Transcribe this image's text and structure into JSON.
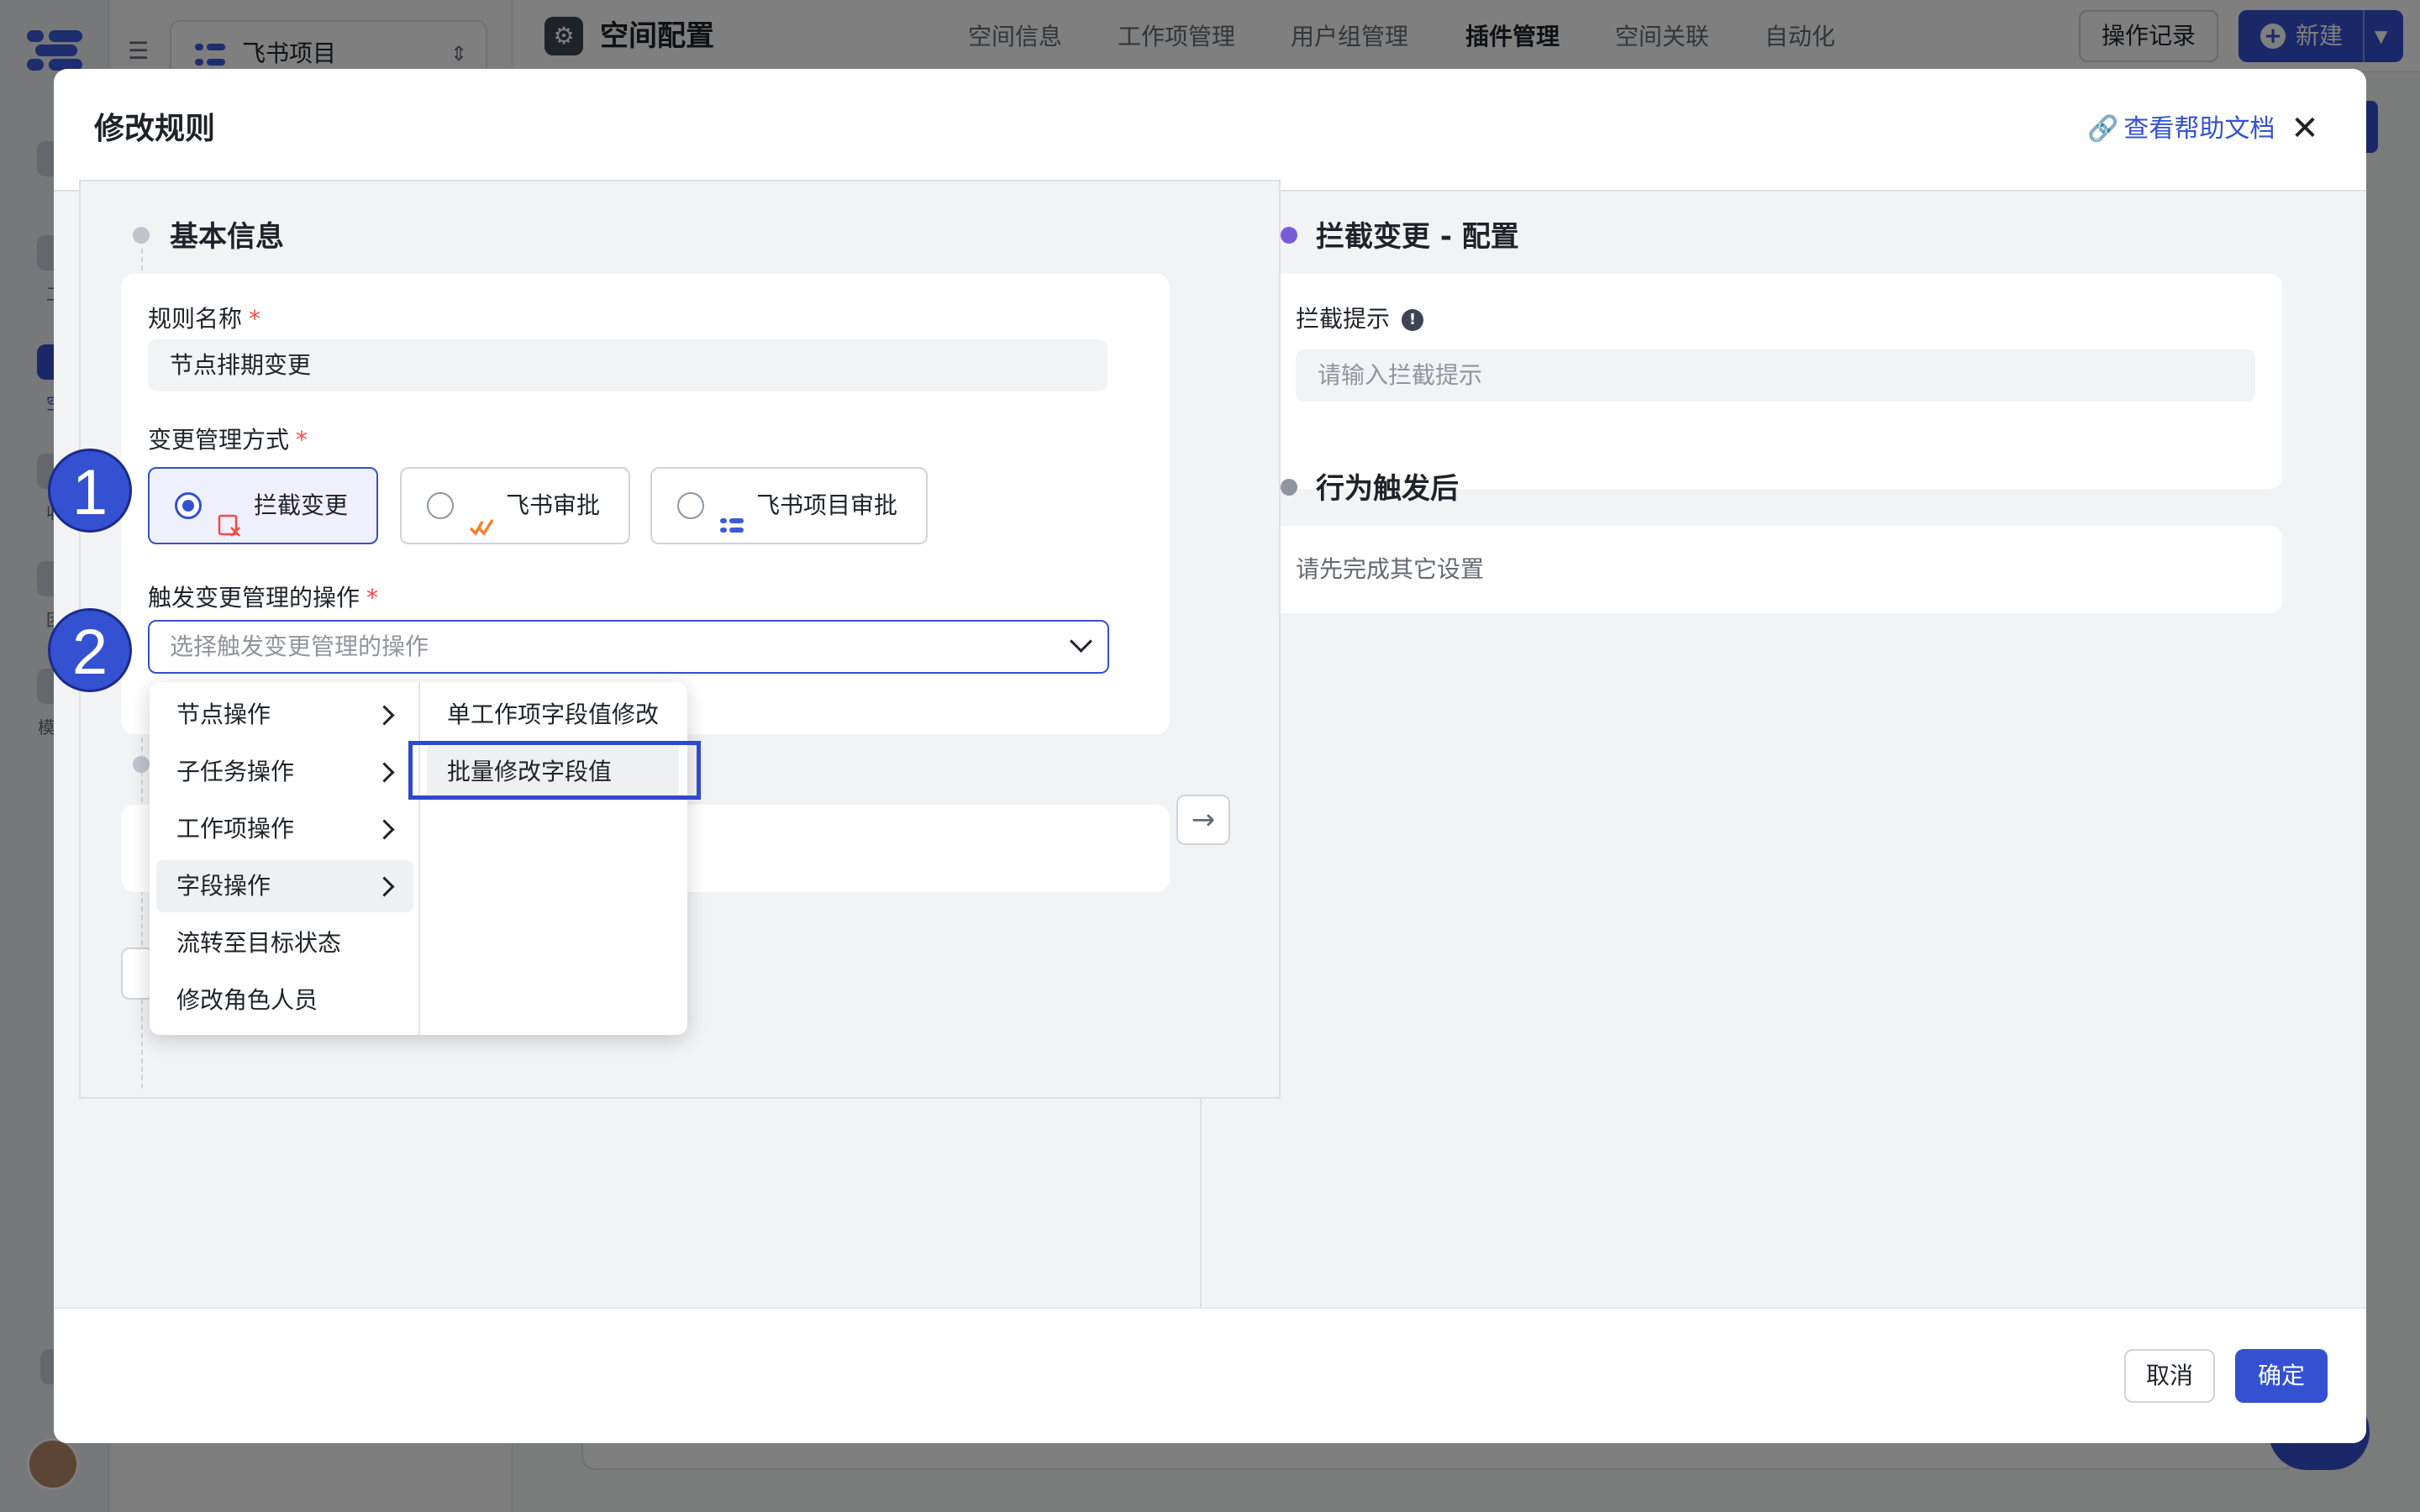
{
  "project": {
    "name": "飞书项目"
  },
  "topbar": {
    "title": "空间配置",
    "tabs": [
      {
        "label": "空间信息"
      },
      {
        "label": "工作项管理"
      },
      {
        "label": "用户组管理"
      },
      {
        "label": "插件管理"
      },
      {
        "label": "空间关联"
      },
      {
        "label": "自动化"
      }
    ],
    "active_tab": "插件管理",
    "oplog": "操作记录",
    "new": "新建"
  },
  "sidebar": {
    "items": [
      {
        "label": "工",
        "icon": "work-icon"
      },
      {
        "label": "空",
        "icon": "space-icon"
      },
      {
        "label": "收",
        "icon": "inbox-icon"
      },
      {
        "label": "团",
        "icon": "team-icon"
      },
      {
        "label": "模板",
        "icon": "template-icon"
      }
    ]
  },
  "modal": {
    "title": "修改规则",
    "help": "查看帮助文档",
    "cancel": "取消",
    "ok": "确定"
  },
  "basic": {
    "section_title": "基本信息",
    "name_label": "规则名称",
    "name_value": "节点排期变更",
    "mode_label": "变更管理方式",
    "modes": [
      {
        "label": "拦截变更",
        "selected": true
      },
      {
        "label": "飞书审批",
        "selected": false
      },
      {
        "label": "飞书项目审批",
        "selected": false
      }
    ],
    "trigger_label": "触发变更管理的操作",
    "trigger_placeholder": "选择触发变更管理的操作"
  },
  "dropdown": {
    "items": [
      {
        "label": "节点操作",
        "has_sub": true
      },
      {
        "label": "子任务操作",
        "has_sub": true
      },
      {
        "label": "工作项操作",
        "has_sub": true
      },
      {
        "label": "字段操作",
        "has_sub": true,
        "active": true
      },
      {
        "label": "流转至目标状态",
        "has_sub": false
      },
      {
        "label": "修改角色人员",
        "has_sub": false
      }
    ],
    "sub_items": [
      {
        "label": "单工作项字段值修改"
      },
      {
        "label": "批量修改字段值",
        "highlighted": true
      }
    ]
  },
  "right": {
    "section_title": "拦截变更 - 配置",
    "hint_label": "拦截提示",
    "hint_placeholder": "请输入拦截提示",
    "after_title": "行为触发后",
    "after_note": "请先完成其它设置"
  },
  "annotations": {
    "step1": "1",
    "step2": "2"
  },
  "colors": {
    "accent": "#3451d1",
    "required": "#f54a45",
    "purple_dot": "#7b5bd6"
  }
}
